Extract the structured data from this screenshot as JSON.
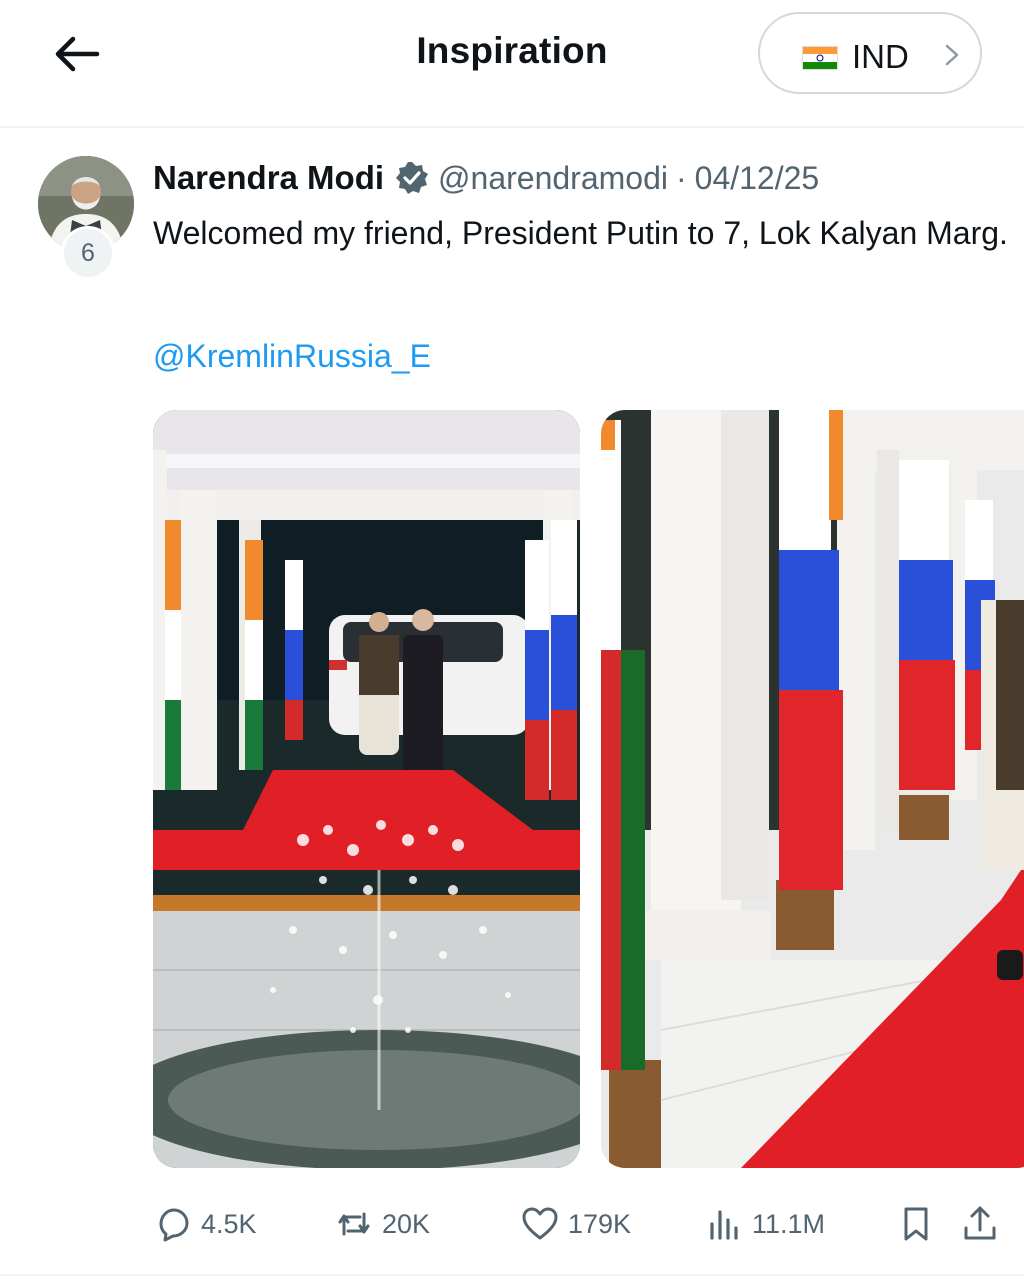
{
  "header": {
    "title": "Inspiration",
    "country": {
      "label": "IND",
      "flag_icon": "india-flag-icon"
    }
  },
  "tweet": {
    "author": {
      "display_name": "Narendra Modi",
      "handle": "@narendramodi",
      "verified": true,
      "badge_count": "6"
    },
    "separator": "·",
    "date": "04/12/25",
    "text": "Welcomed my friend, President Putin to 7, Lok Kalyan Marg.",
    "mention": "@KremlinRussia_E",
    "media": [
      {
        "icon": "photo-leaders-handshake-portico"
      },
      {
        "icon": "photo-flag-lined-red-carpet-corridor"
      }
    ],
    "actions": {
      "replies": "4.5K",
      "reposts": "20K",
      "likes": "179K",
      "views": "11.1M"
    }
  },
  "colors": {
    "link": "#1d9bf0",
    "secondary_text": "#536471",
    "divider": "#eff3f4",
    "carpet": "#e11f26"
  }
}
